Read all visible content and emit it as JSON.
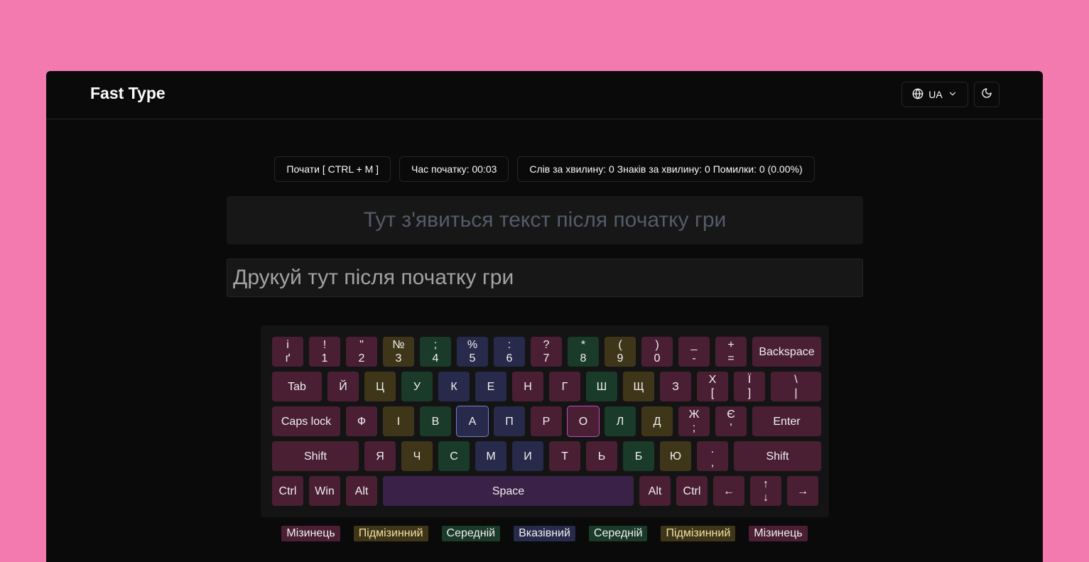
{
  "header": {
    "brand": "Fast Type",
    "language": "UA",
    "globe_icon": "globe-icon",
    "chevron_icon": "chevron-down-icon",
    "theme_icon": "moon-icon"
  },
  "stats": {
    "start_label": "Почати [ CTRL + M ]",
    "time_label": "Час початку: 00:03",
    "summary_label": "Слів за хвилину: 0 Знаків за хвилину: 0 Помилки: 0 (0.00%)"
  },
  "text_display": "Тут з'явиться текст після початку гри",
  "input": {
    "placeholder": "Друкуй тут після початку гри",
    "value": ""
  },
  "keyboard": {
    "rows": [
      [
        {
          "top": "і",
          "bottom": "ґ",
          "color": "pink"
        },
        {
          "top": "!",
          "bottom": "1",
          "color": "pink"
        },
        {
          "top": "\"",
          "bottom": "2",
          "color": "pink"
        },
        {
          "top": "№",
          "bottom": "3",
          "color": "olive"
        },
        {
          "top": ";",
          "bottom": "4",
          "color": "green"
        },
        {
          "top": "%",
          "bottom": "5",
          "color": "navy"
        },
        {
          "top": ":",
          "bottom": "6",
          "color": "navy"
        },
        {
          "top": "?",
          "bottom": "7",
          "color": "pink"
        },
        {
          "top": "*",
          "bottom": "8",
          "color": "green"
        },
        {
          "top": "(",
          "bottom": "9",
          "color": "olive"
        },
        {
          "top": ")",
          "bottom": "0",
          "color": "pink"
        },
        {
          "top": "_",
          "bottom": "-",
          "color": "pink"
        },
        {
          "top": "+",
          "bottom": "=",
          "color": "pink"
        },
        {
          "label": "Backspace",
          "color": "pink"
        }
      ],
      [
        {
          "label": "Tab",
          "color": "pink"
        },
        {
          "label": "Й",
          "color": "pink"
        },
        {
          "label": "Ц",
          "color": "olive"
        },
        {
          "label": "У",
          "color": "green"
        },
        {
          "label": "К",
          "color": "navy"
        },
        {
          "label": "Е",
          "color": "navy"
        },
        {
          "label": "Н",
          "color": "pink"
        },
        {
          "label": "Г",
          "color": "pink"
        },
        {
          "label": "Ш",
          "color": "green"
        },
        {
          "label": "Щ",
          "color": "olive"
        },
        {
          "label": "З",
          "color": "pink"
        },
        {
          "top": "Х",
          "bottom": "[",
          "color": "pink"
        },
        {
          "top": "Ї",
          "bottom": "]",
          "color": "pink"
        },
        {
          "top": "\\",
          "bottom": "|",
          "color": "pink"
        }
      ],
      [
        {
          "label": "Caps lock",
          "color": "pink"
        },
        {
          "label": "Ф",
          "color": "pink"
        },
        {
          "label": "І",
          "color": "olive"
        },
        {
          "label": "В",
          "color": "green"
        },
        {
          "label": "А",
          "color": "navy",
          "highlight": "blue"
        },
        {
          "label": "П",
          "color": "navy"
        },
        {
          "label": "Р",
          "color": "pink"
        },
        {
          "label": "О",
          "color": "pink",
          "highlight": "pink"
        },
        {
          "label": "Л",
          "color": "green"
        },
        {
          "label": "Д",
          "color": "olive"
        },
        {
          "top": "Ж",
          "bottom": ";",
          "color": "pink"
        },
        {
          "top": "Є",
          "bottom": "'",
          "color": "pink"
        },
        {
          "label": "Enter",
          "color": "pink"
        }
      ],
      [
        {
          "label": "Shift",
          "color": "pink"
        },
        {
          "label": "Я",
          "color": "pink"
        },
        {
          "label": "Ч",
          "color": "olive"
        },
        {
          "label": "С",
          "color": "green"
        },
        {
          "label": "М",
          "color": "navy"
        },
        {
          "label": "И",
          "color": "navy"
        },
        {
          "label": "Т",
          "color": "pink"
        },
        {
          "label": "Ь",
          "color": "pink"
        },
        {
          "label": "Б",
          "color": "green"
        },
        {
          "label": "Ю",
          "color": "olive"
        },
        {
          "top": ".",
          "bottom": ",",
          "color": "pink"
        },
        {
          "label": "Shift",
          "color": "pink"
        }
      ],
      [
        {
          "label": "Ctrl",
          "color": "pink"
        },
        {
          "label": "Win",
          "color": "pink"
        },
        {
          "label": "Alt",
          "color": "pink"
        },
        {
          "label": "Space",
          "color": "space"
        },
        {
          "label": "Alt",
          "color": "pink"
        },
        {
          "label": "Ctrl",
          "color": "pink"
        },
        {
          "label": "←",
          "color": "pink"
        },
        {
          "top": "↑",
          "bottom": "↓",
          "color": "pink"
        },
        {
          "label": "→",
          "color": "pink"
        }
      ]
    ]
  },
  "legend": [
    {
      "label": "Мізинець",
      "color": "pink"
    },
    {
      "label": "Підмізинний",
      "color": "olive"
    },
    {
      "label": "Середній",
      "color": "green"
    },
    {
      "label": "Вказівний",
      "color": "navy"
    },
    {
      "label": "Середній",
      "color": "green"
    },
    {
      "label": "Підмізинний",
      "color": "olive"
    },
    {
      "label": "Мізинець",
      "color": "pink"
    }
  ]
}
